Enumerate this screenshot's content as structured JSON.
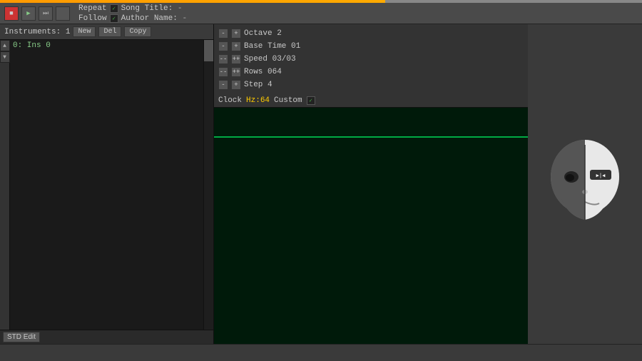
{
  "topbar": {
    "repeat_label": "Repeat",
    "follow_label": "Follow",
    "repeat_checked": true,
    "follow_checked": true,
    "song_title_label": "Song Title:",
    "song_title_value": "-",
    "author_name_label": "Author Name:",
    "author_name_value": "-"
  },
  "instruments": {
    "label": "Instruments:",
    "count": "1",
    "new_btn": "New",
    "del_btn": "Del",
    "copy_btn": "Copy",
    "items": [
      {
        "index": "0:",
        "name": "Ins 0"
      }
    ],
    "edit_btn": "STD Edit"
  },
  "pattern": {
    "octave_label": "Octave 2",
    "basetime_label": "Base Time 01",
    "speed_label": "Speed 03/03",
    "rows_label": "Rows 064",
    "step_label": "Step 4",
    "clock_label": "Clock",
    "clock_value": "Hz:64",
    "custom_label": "Custom"
  },
  "buttons": {
    "stop": "■",
    "play": "▶",
    "skip": "⏭",
    "record": ""
  }
}
